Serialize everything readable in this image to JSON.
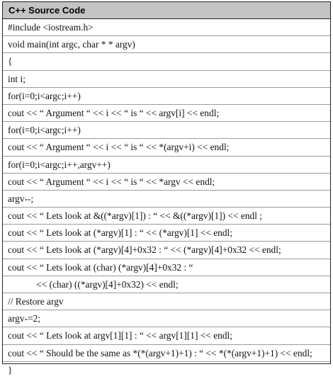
{
  "header": {
    "title": "C++ Source Code"
  },
  "lines": [
    "#include <iostream.h>",
    "void main(int argc, char * * argv)",
    "{",
    "int i;",
    "for(i=0;i<argc;i++)",
    "cout << “ Argument “ << i << “ is “ << argv[i] << endl;",
    "for(i=0;i<argc;i++)",
    "cout << “ Argument “ << i << “ is “ << *(argv+i) << endl;",
    "for(i=0;i<argc;i++,argv++)",
    "cout << “ Argument “ << i << “ is “ << *argv << endl;",
    "argv--;",
    "cout << “ Lets look at &((*argv)[1]) : “ << &((*argv)[1]) << endl ;",
    "cout << “ Lets look at (*argv)[1] : “ << (*argv)[1] << endl;",
    "cout << “ Lets look at (*argv)[4]+0x32 : “ << (*argv)[4]+0x32 << endl;",
    "cout << “ Lets look at (char) (*argv)[4]+0x32 : “",
    "            << (char) ((*argv)[4]+0x32) << endl;",
    "// Restore argv",
    "argv-=2;",
    "cout << “ Lets look at argv[1][1] : “ << argv[1][1] << endl;",
    "cout << “ Should be the same as *(*(argv+1)+1) : “ << *(*(argv+1)+1) << endl;",
    "}"
  ]
}
